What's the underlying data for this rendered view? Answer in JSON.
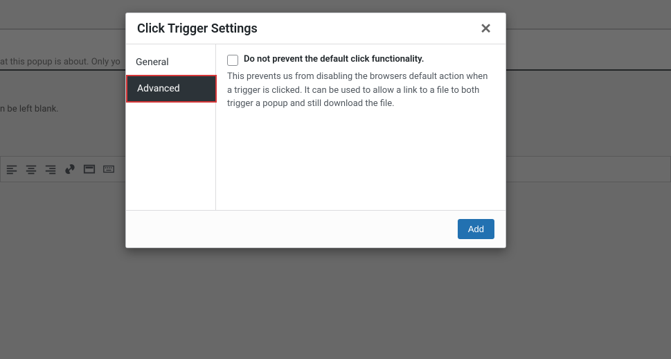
{
  "background": {
    "text1": "at this popup is about. Only yo",
    "text2": "n be left blank."
  },
  "modal": {
    "title": "Click Trigger Settings",
    "tabs": {
      "general": "General",
      "advanced": "Advanced"
    },
    "option": {
      "label": "Do not prevent the default click functionality.",
      "description": "This prevents us from disabling the browsers default action when a trigger is clicked. It can be used to allow a link to a file to both trigger a popup and still download the file."
    },
    "footer": {
      "add": "Add"
    }
  }
}
